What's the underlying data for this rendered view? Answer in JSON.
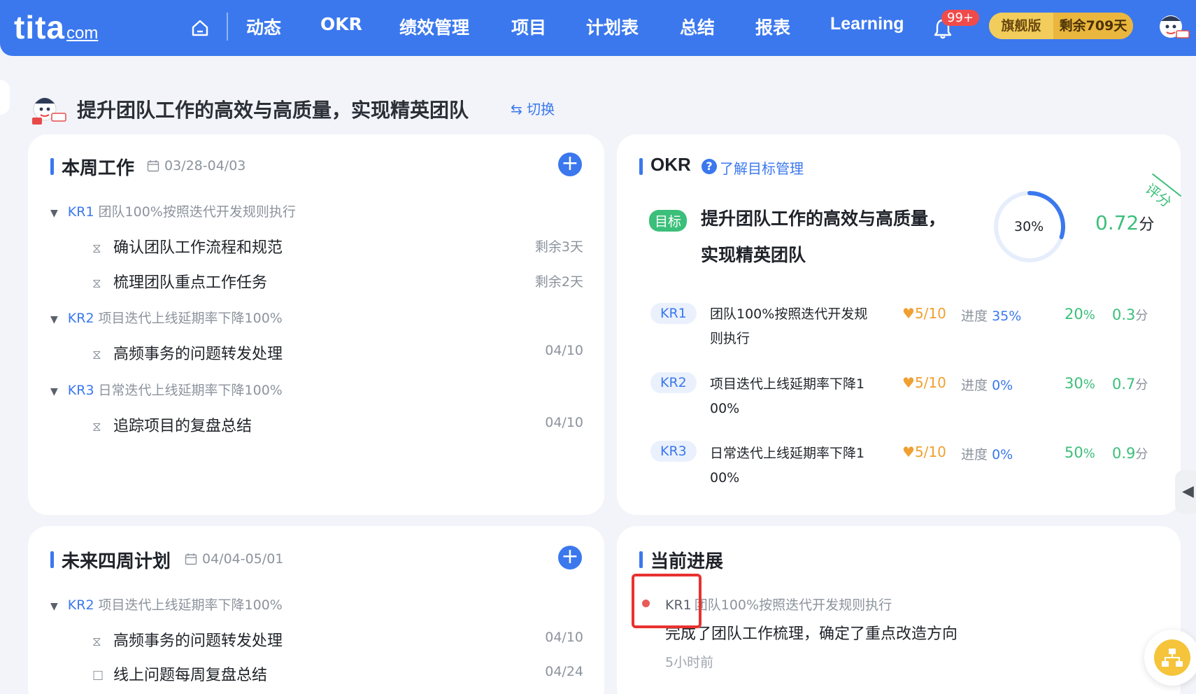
{
  "nav": {
    "logo_main": "tita",
    "logo_suffix": "com",
    "items": [
      "动态",
      "OKR",
      "绩效管理",
      "项目",
      "计划表",
      "总结",
      "报表",
      "Learning"
    ],
    "notification_badge": "99+",
    "plan_label": "旗舰版",
    "remaining_label": "剩余709天"
  },
  "header": {
    "title": "提升团队工作的高效与高质量，实现精英团队",
    "switch_label": "⇆ 切换"
  },
  "this_week": {
    "title": "本周工作",
    "date_range": "03/28-04/03",
    "groups": [
      {
        "code": "KR1",
        "text": "团队100%按照迭代开发规则执行",
        "tasks": [
          {
            "name": "确认团队工作流程和规范",
            "meta": "剩余3天"
          },
          {
            "name": "梳理团队重点工作任务",
            "meta": "剩余2天"
          }
        ]
      },
      {
        "code": "KR2",
        "text": "项目迭代上线延期率下降100%",
        "tasks": [
          {
            "name": "高频事务的问题转发处理",
            "meta": "04/10"
          }
        ]
      },
      {
        "code": "KR3",
        "text": "日常迭代上线延期率下降100%",
        "tasks": [
          {
            "name": "追踪项目的复盘总结",
            "meta": "04/10"
          }
        ]
      }
    ]
  },
  "okr": {
    "title": "OKR",
    "help_link": "了解目标管理",
    "goal_tag": "目标",
    "goal_line1": "提升团队工作的高效与高质量，",
    "goal_line2": "实现精英团队",
    "progress_label": "30%",
    "progress_fraction": 0.3,
    "score_value": "0.72",
    "score_unit": "分",
    "stamp": "评分",
    "key_results": [
      {
        "code": "KR1",
        "line1": "团队100%按照迭代开发规",
        "line2": "则执行",
        "confidence": "5/10",
        "progress_label": "进度",
        "progress": "35%",
        "weight": "20",
        "score": "0.3"
      },
      {
        "code": "KR2",
        "line1": "项目迭代上线延期率下降1",
        "line2": "00%",
        "confidence": "5/10",
        "progress_label": "进度",
        "progress": "0%",
        "weight": "30",
        "score": "0.7"
      },
      {
        "code": "KR3",
        "line1": "日常迭代上线延期率下降1",
        "line2": "00%",
        "confidence": "5/10",
        "progress_label": "进度",
        "progress": "0%",
        "weight": "50",
        "score": "0.9"
      }
    ],
    "percent_sign": "%",
    "score_unit_small": "分"
  },
  "next_four_weeks": {
    "title": "未来四周计划",
    "date_range": "04/04-05/01",
    "groups": [
      {
        "code": "KR2",
        "text": "项目迭代上线延期率下降100%",
        "tasks": [
          {
            "name": "高频事务的问题转发处理",
            "meta": "04/10",
            "icon": "hourglass"
          },
          {
            "name": "线上问题每周复盘总结",
            "meta": "04/24",
            "icon": "checkbox"
          }
        ]
      }
    ]
  },
  "current_progress": {
    "title": "当前进展",
    "kr_code": "KR1",
    "kr_text": "团队100%按照迭代开发规则执行",
    "update_text": "完成了团队工作梳理，确定了重点改造方向",
    "time": "5小时前"
  },
  "colors": {
    "brand": "#3b78ee",
    "success": "#3bbf7a",
    "warning": "#f0a030",
    "highlight_box": "#e8322e"
  }
}
